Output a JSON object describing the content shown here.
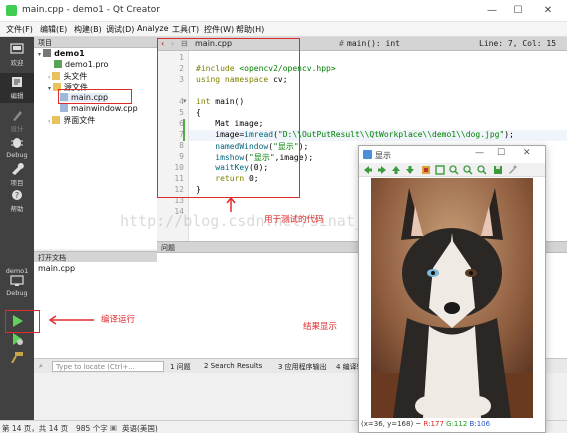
{
  "window": {
    "title": "main.cpp - demo1 - Qt Creator",
    "minimize": "—",
    "maximize": "☐",
    "close": "✕"
  },
  "menu": [
    "文件(F)",
    "编辑(E)",
    "构建(B)",
    "调试(D)",
    "Analyze",
    "工具(T)",
    "控件(W)",
    "帮助(H)"
  ],
  "modes": {
    "welcome": "欢迎",
    "edit": "编辑",
    "design": "设计",
    "debug": "Debug",
    "project": "项目",
    "help": "帮助",
    "kit": "demo1",
    "kit_mode": "Debug"
  },
  "project": {
    "header": "项目",
    "tree": [
      "demo1",
      "demo1.pro",
      "头文件",
      "源文件",
      "main.cpp",
      "mainwindow.cpp",
      "界面文件"
    ]
  },
  "open_docs": {
    "header": "打开文档",
    "items": [
      "main.cpp"
    ]
  },
  "editor": {
    "tab": "main.cpp",
    "symbol": "main(): int",
    "position": "Line: 7, Col: 15",
    "lines": [
      "1",
      "2",
      "3",
      "4",
      "5",
      "6",
      "7",
      "8",
      "9",
      "10",
      "11",
      "12",
      "13",
      "14"
    ]
  },
  "issues": {
    "header": "问题"
  },
  "bottom": {
    "locator_placeholder": "Type to locate (Ctrl+...",
    "tabs": [
      "1 问题",
      "2 Search Results",
      "3 应用程序输出",
      "4 编译输出"
    ]
  },
  "status": {
    "pages": "第 14 页，共 14 页",
    "words": "985 个字",
    "lang": "英语(美国)"
  },
  "image_window": {
    "title": "显示",
    "pixel_info": "(x=36, y=168) ~",
    "r": "R:177",
    "g": "G:112",
    "b": "B:106"
  },
  "annotations": {
    "code": "用于测试的代码",
    "run": "编译运行",
    "result": "结果显示",
    "watermark": "http://blog.csdn.net/sinat_36264666"
  },
  "colors": {
    "annotation_red": "#e02b2b",
    "modebar": "#414141",
    "qt_green": "#41cd52"
  }
}
